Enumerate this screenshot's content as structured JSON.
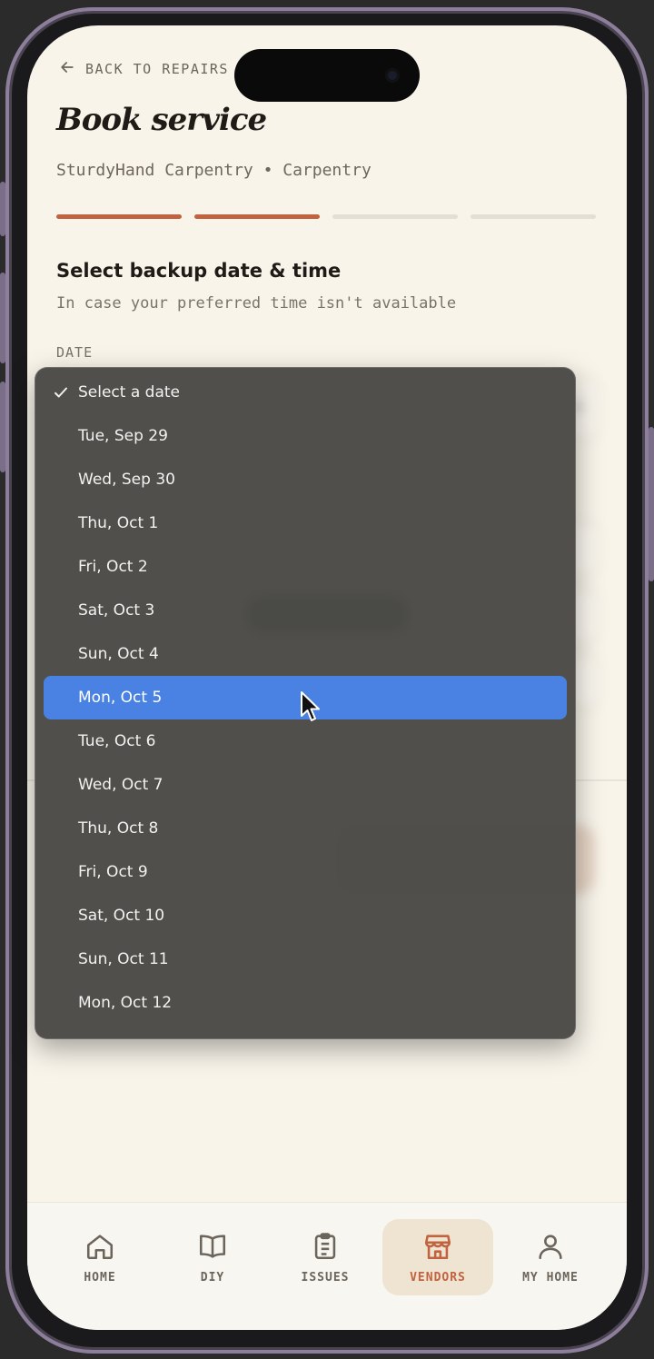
{
  "header": {
    "back_label": "BACK TO REPAIRS",
    "title": "Book service",
    "subtitle": "SturdyHand Carpentry • Carpentry"
  },
  "progress": {
    "total_steps": 4,
    "completed_steps": 2
  },
  "section": {
    "title": "Select backup date & time",
    "subtitle": "In case your preferred time isn't available",
    "date_label": "DATE"
  },
  "dropdown": {
    "selected": "Select a date",
    "highlighted": "Mon, Oct 5",
    "options": [
      "Select a date",
      "Tue, Sep 29",
      "Wed, Sep 30",
      "Thu, Oct 1",
      "Fri, Oct 2",
      "Sat, Oct 3",
      "Sun, Oct 4",
      "Mon, Oct 5",
      "Tue, Oct 6",
      "Wed, Oct 7",
      "Thu, Oct 8",
      "Fri, Oct 9",
      "Sat, Oct 10",
      "Sun, Oct 11",
      "Mon, Oct 12"
    ]
  },
  "nav": {
    "items": [
      {
        "label": "HOME",
        "icon": "home-icon"
      },
      {
        "label": "DIY",
        "icon": "book-icon"
      },
      {
        "label": "ISSUES",
        "icon": "clipboard-icon"
      },
      {
        "label": "VENDORS",
        "icon": "store-icon",
        "active": true
      },
      {
        "label": "MY HOME",
        "icon": "user-icon"
      }
    ]
  },
  "colors": {
    "accent": "#c1633f",
    "background": "#f8f4ea",
    "highlight": "#4a82e4"
  }
}
